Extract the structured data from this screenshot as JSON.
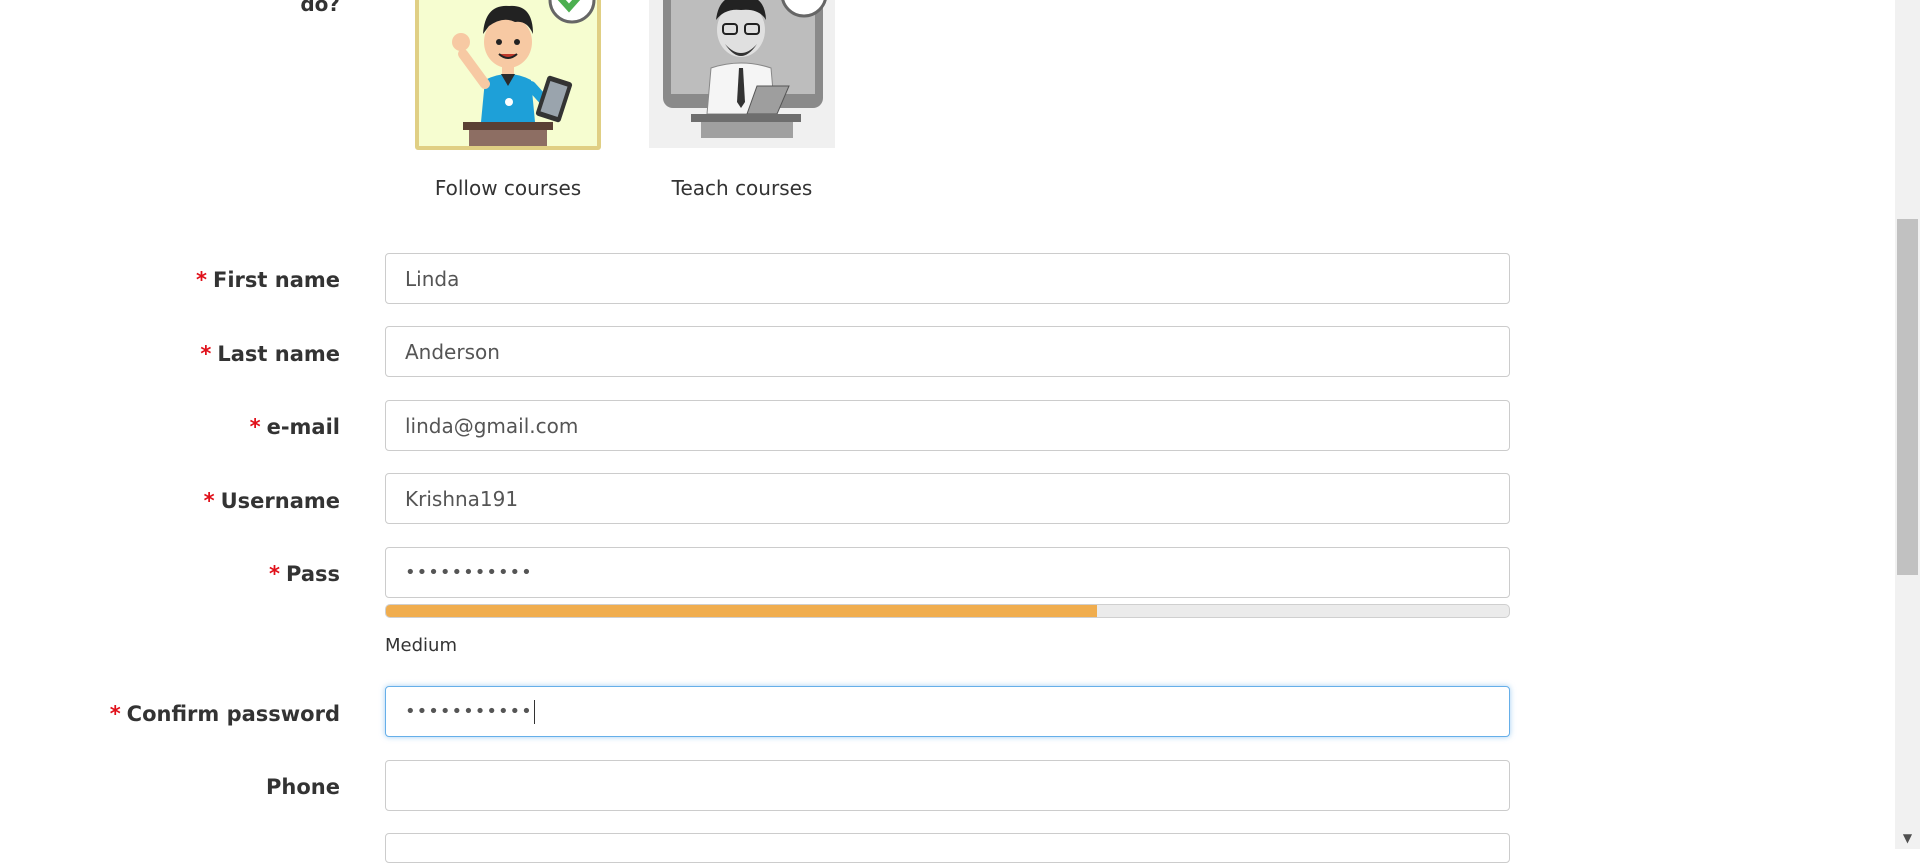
{
  "role_question": {
    "label": "do?"
  },
  "roles": [
    {
      "caption": "Follow courses",
      "selected": true,
      "icon": "student-avatar-icon"
    },
    {
      "caption": "Teach courses",
      "selected": false,
      "icon": "teacher-avatar-icon"
    }
  ],
  "form": {
    "first_name": {
      "label": "First name",
      "value": "Linda"
    },
    "last_name": {
      "label": "Last name",
      "value": "Anderson"
    },
    "email": {
      "label": "e-mail",
      "value": "linda@gmail.com"
    },
    "username": {
      "label": "Username",
      "value": "Krishna191"
    },
    "pass": {
      "label": "Pass",
      "value": "•••••••••••"
    },
    "password_strength": {
      "text": "Medium",
      "level": 0.633
    },
    "confirm_password": {
      "label": "Confirm password",
      "value": "•••••••••••"
    },
    "phone": {
      "label": "Phone",
      "value": ""
    }
  },
  "required_marker": "*",
  "colors": {
    "required": "#e0101a",
    "strength_fill": "#f0ad4e",
    "focus_border": "#66afe9",
    "selected_card_border": "#e0cf84",
    "selected_card_bg": "#f6fdd0",
    "check_green": "#4caf50"
  }
}
